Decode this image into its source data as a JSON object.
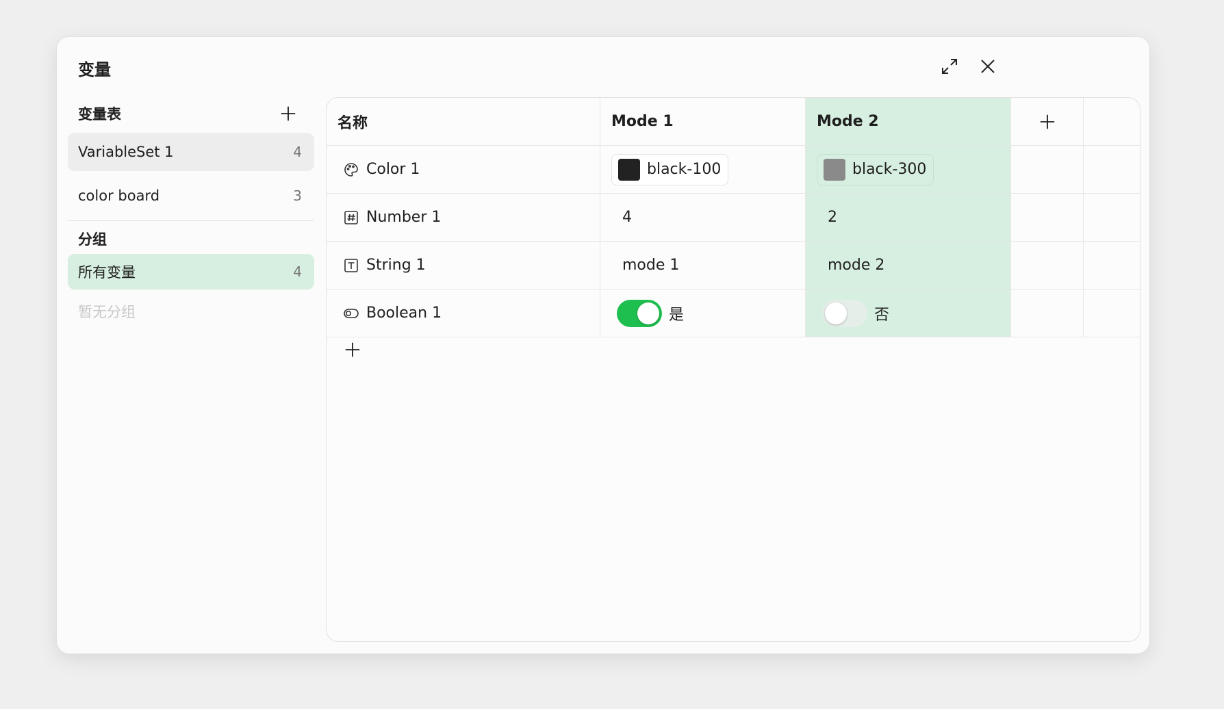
{
  "dialog": {
    "title": "变量",
    "expand_icon": "expand-icon",
    "close_icon": "close-icon"
  },
  "sidebar": {
    "sets_header": "变量表",
    "add_icon": "plus-icon",
    "sets": [
      {
        "label": "VariableSet 1",
        "count": "4"
      },
      {
        "label": "color board",
        "count": "3"
      }
    ],
    "groups_header": "分组",
    "groups": [
      {
        "label": "所有变量",
        "count": "4"
      }
    ],
    "empty_groups": "暂无分组"
  },
  "table": {
    "headers": {
      "name": "名称",
      "mode1": "Mode 1",
      "mode2": "Mode 2"
    },
    "rows": [
      {
        "type": "color",
        "icon": "palette-icon",
        "name": "Color 1",
        "mode1": {
          "label": "black-100",
          "color": "#222222"
        },
        "mode2": {
          "label": "black-300",
          "color": "#8a8a8a"
        }
      },
      {
        "type": "number",
        "icon": "number-icon",
        "name": "Number 1",
        "mode1": "4",
        "mode2": "2"
      },
      {
        "type": "string",
        "icon": "text-icon",
        "name": "String 1",
        "mode1": "mode 1",
        "mode2": "mode 2"
      },
      {
        "type": "boolean",
        "icon": "toggle-icon",
        "name": "Boolean 1",
        "mode1": {
          "on": true,
          "label": "是"
        },
        "mode2": {
          "on": false,
          "label": "否"
        }
      }
    ]
  },
  "colors": {
    "accent_green": "#1fbf4f",
    "selected_column": "#d7efe0"
  }
}
